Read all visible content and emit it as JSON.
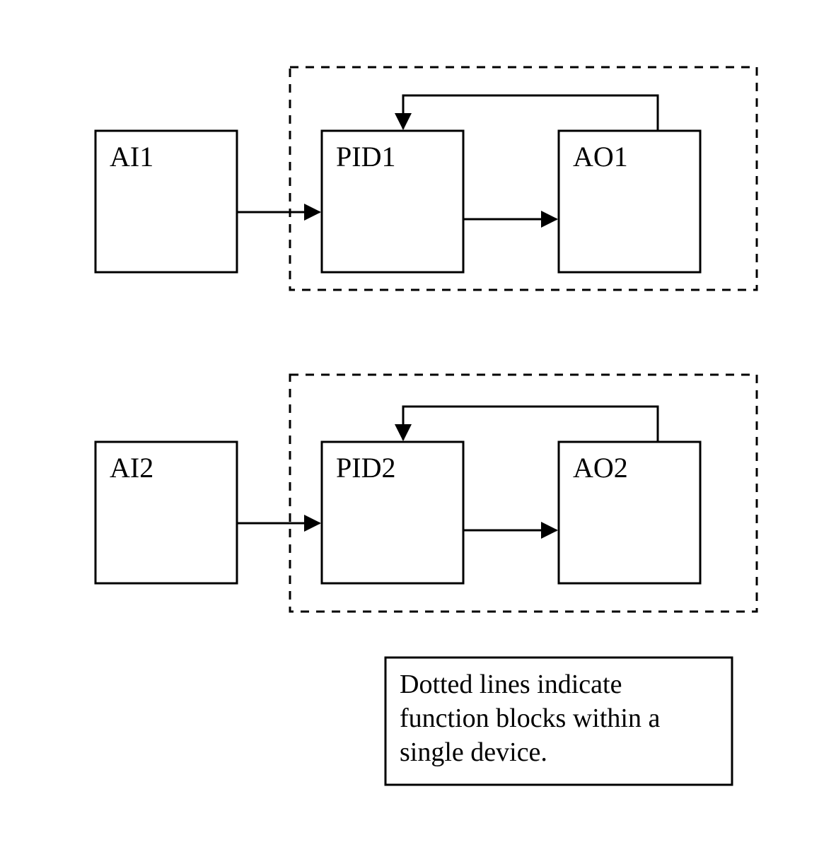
{
  "diagram": {
    "loops": [
      {
        "ai": {
          "name": "ai1-block",
          "label": "AI1"
        },
        "pid": {
          "name": "pid1-block",
          "label": "PID1"
        },
        "ao": {
          "name": "ao1-block",
          "label": "AO1"
        }
      },
      {
        "ai": {
          "name": "ai2-block",
          "label": "AI2"
        },
        "pid": {
          "name": "pid2-block",
          "label": "PID2"
        },
        "ao": {
          "name": "ao2-block",
          "label": "AO2"
        }
      }
    ],
    "legend": {
      "line1": "Dotted lines indicate",
      "line2": "function blocks within a",
      "line3": "single device."
    }
  }
}
